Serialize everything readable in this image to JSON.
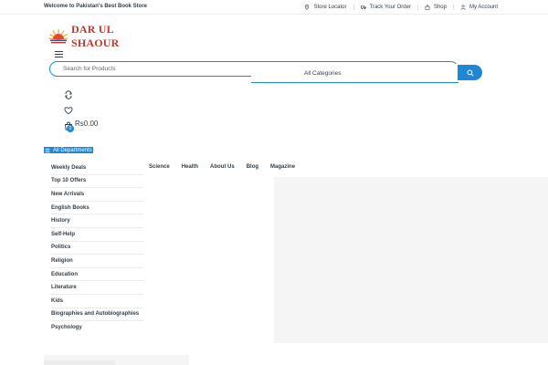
{
  "topbar": {
    "welcome": "Welcome to Pakistan's Best Book Store",
    "links": [
      {
        "label": "Store Locator",
        "icon": "map-pin-icon"
      },
      {
        "label": "Track Your Order",
        "icon": "truck-icon"
      },
      {
        "label": "Shop",
        "icon": "shopping-bag-icon"
      },
      {
        "label": "My Account",
        "icon": "user-icon"
      }
    ]
  },
  "logo": {
    "text": "DAR UL SHAOUR"
  },
  "search": {
    "placeholder": "Search for Products",
    "category": "All Categories"
  },
  "header_icons": [
    "compare-icon",
    "heart-icon",
    "cart-icon"
  ],
  "cart": {
    "total": "Rs0.00",
    "count": "0"
  },
  "departments": {
    "button_label": "All Departments",
    "items": [
      "Weekly Deals",
      "Top 10 Offers",
      "New Arrivals",
      "English Books",
      "History",
      "Self-Help",
      "Politics",
      "Religion",
      "Education",
      "Literature",
      "Kids",
      "Biographies and Autobiographies",
      "Psychology"
    ]
  },
  "nav": [
    "Science",
    "Health",
    "About Us",
    "Blog",
    "Magazine"
  ],
  "colors": {
    "accent": "#1e88d6",
    "brand": "#c5372c",
    "text": "#333e48"
  }
}
